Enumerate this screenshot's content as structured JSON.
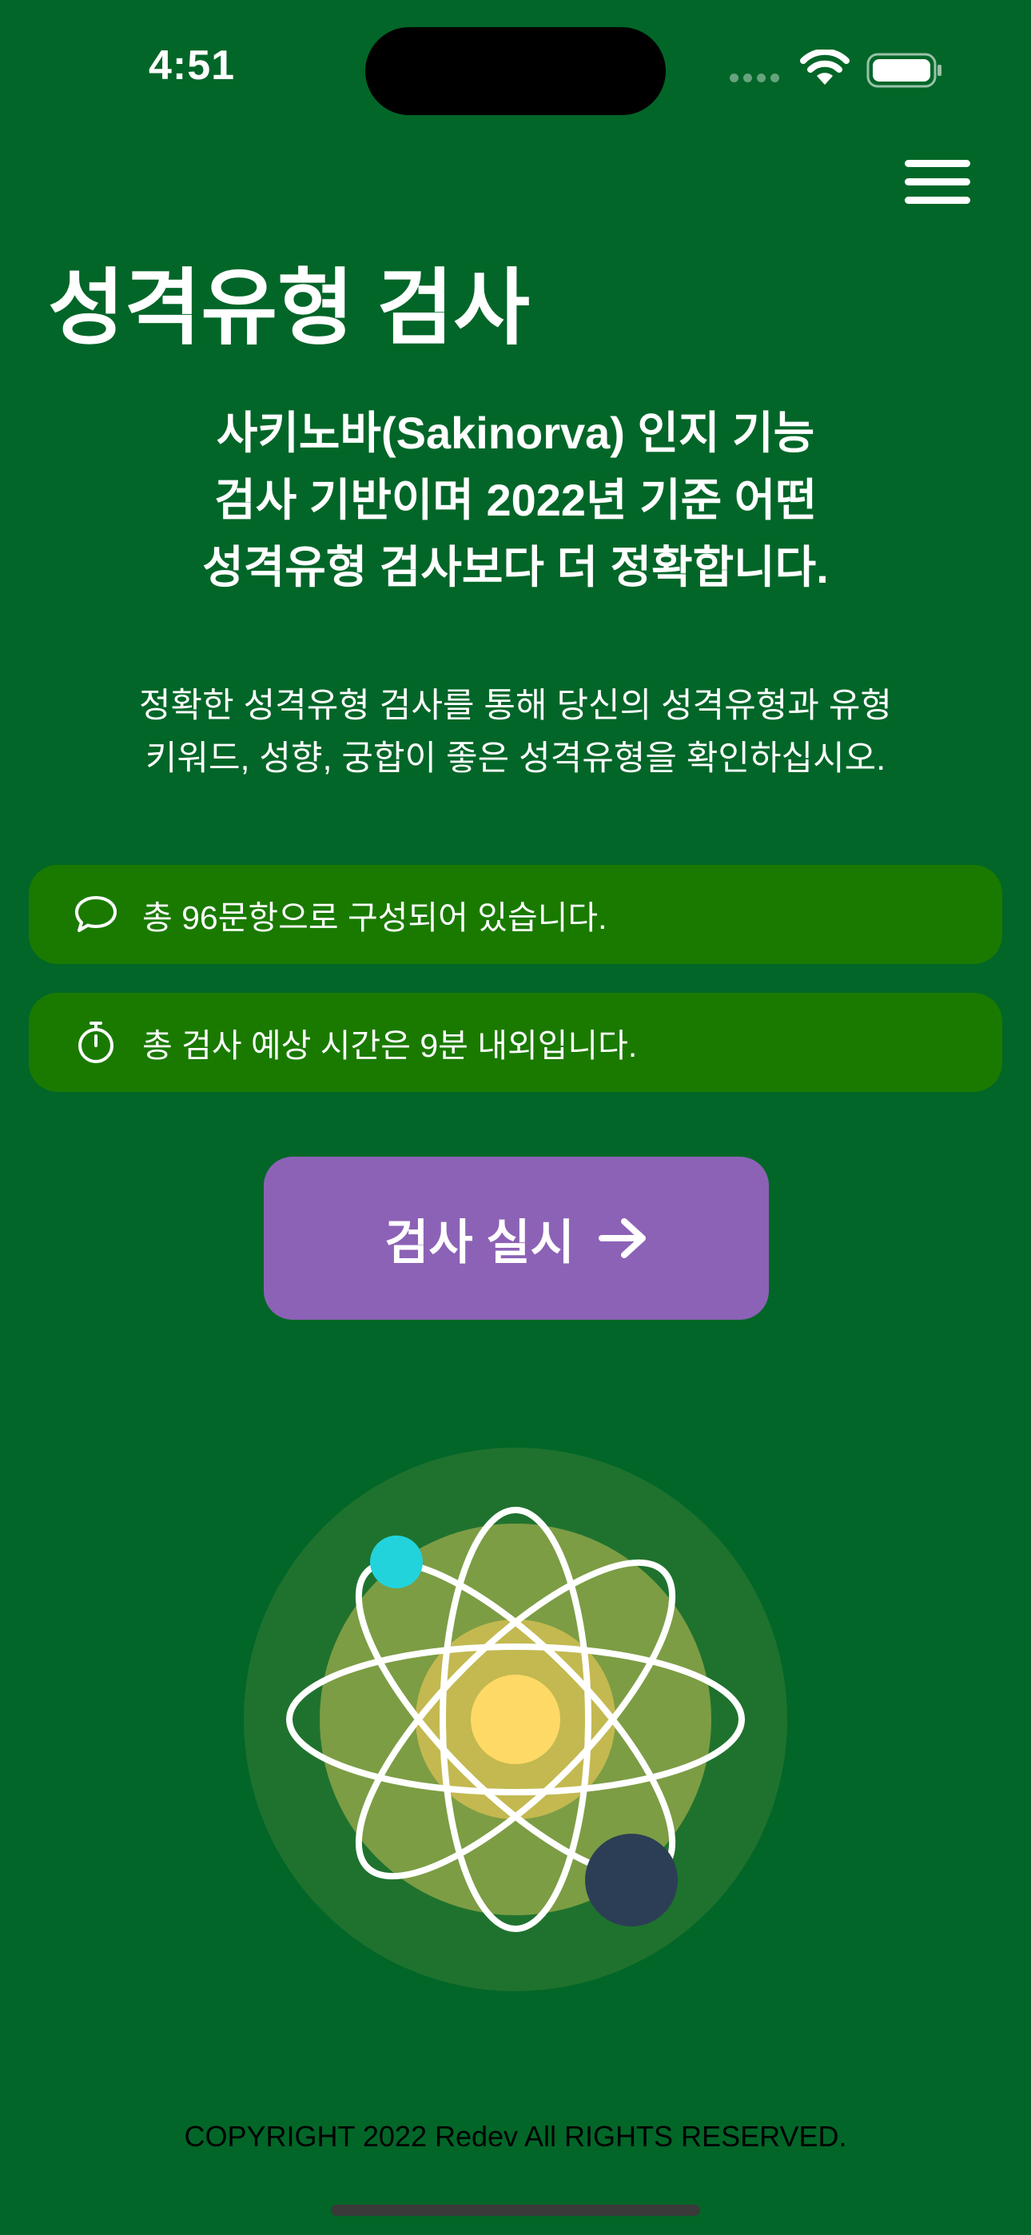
{
  "status_bar": {
    "time": "4:51"
  },
  "header": {
    "title": "성격유형 검사"
  },
  "headline": {
    "lines": [
      "사키노바(Sakinorva) 인지 기능",
      "검사 기반이며 2022년 기준 어떤",
      "성격유형 검사보다 더 정확합니다."
    ]
  },
  "description": {
    "lines": [
      "정확한 성격유형 검사를 통해 당신의 성격유형과 유형",
      "키워드, 성향, 궁합이 좋은 성격유형을 확인하십시오."
    ]
  },
  "info_cards": [
    {
      "icon": "speech-bubble-icon",
      "text": "총 96문항으로 구성되어 있습니다."
    },
    {
      "icon": "stopwatch-icon",
      "text": "총 검사 예상 시간은 9분 내외입니다."
    }
  ],
  "start_button": {
    "label": "검사 실시"
  },
  "footer": {
    "copyright": "COPYRIGHT 2022 Redev All RIGHTS RESERVED."
  },
  "colors": {
    "background": "#026628",
    "card": "#1a7a00",
    "button": "#8c62b6",
    "nucleus": "#ffd966",
    "electron_small": "#22d3dc",
    "electron_large": "#2c3e55"
  }
}
